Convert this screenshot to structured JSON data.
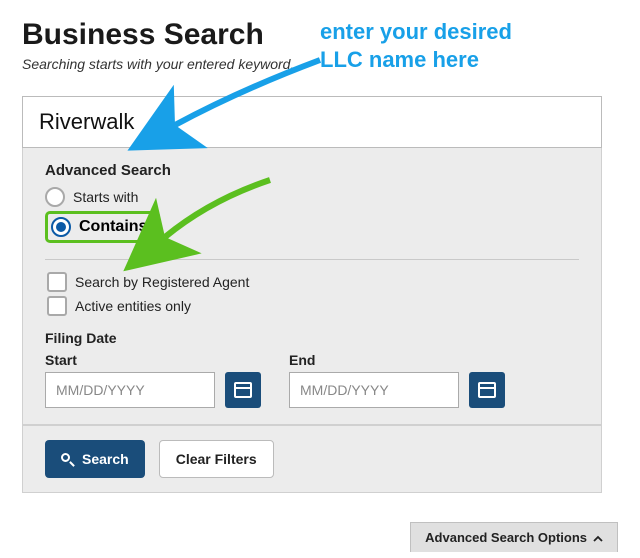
{
  "header": {
    "title": "Business Search",
    "subtitle": "Searching starts with your entered keyword."
  },
  "search": {
    "value": "Riverwalk"
  },
  "advanced": {
    "title": "Advanced Search",
    "radios": {
      "starts_with": "Starts with",
      "contains": "Contains"
    },
    "checks": {
      "registered_agent": "Search by Registered Agent",
      "active_only": "Active entities only"
    },
    "filing_date": {
      "title": "Filing Date",
      "start_label": "Start",
      "end_label": "End",
      "placeholder": "MM/DD/YYYY"
    }
  },
  "actions": {
    "search": "Search",
    "clear": "Clear Filters"
  },
  "toggle": {
    "label": "Advanced Search Options"
  },
  "annotation": {
    "text": "enter your desired\nLLC name here"
  }
}
